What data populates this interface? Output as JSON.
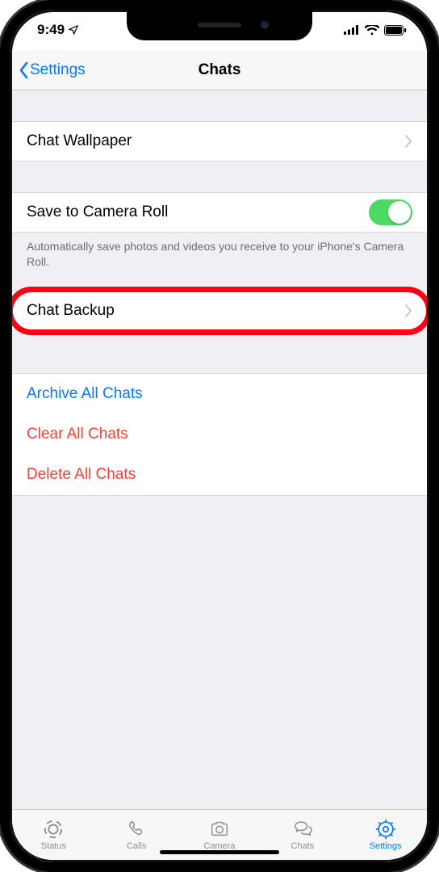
{
  "status": {
    "time": "9:49"
  },
  "nav": {
    "back": "Settings",
    "title": "Chats"
  },
  "rows": {
    "wallpaper": "Chat Wallpaper",
    "save_camera": "Save to Camera Roll",
    "save_camera_note": "Automatically save photos and videos you receive to your iPhone's Camera Roll.",
    "backup": "Chat Backup",
    "archive": "Archive All Chats",
    "clear": "Clear All Chats",
    "delete": "Delete All Chats"
  },
  "tabs": {
    "status": "Status",
    "calls": "Calls",
    "camera": "Camera",
    "chats": "Chats",
    "settings": "Settings"
  }
}
